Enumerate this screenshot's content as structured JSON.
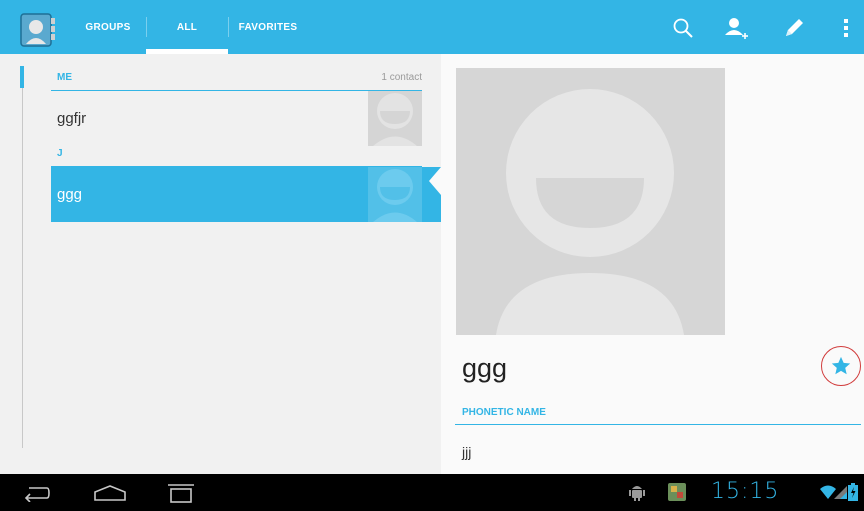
{
  "action_bar": {
    "color": "#33b5e5",
    "tabs": [
      {
        "label": "GROUPS",
        "selected": false
      },
      {
        "label": "ALL",
        "selected": true
      },
      {
        "label": "FAVORITES",
        "selected": false
      }
    ],
    "actions": [
      "search-icon",
      "add-contact-icon",
      "edit-icon",
      "overflow-menu-icon"
    ]
  },
  "contact_list": {
    "sections": [
      {
        "title": "ME",
        "count": "1 contact"
      },
      {
        "title": "J",
        "count": ""
      }
    ],
    "contacts": [
      {
        "name": "ggfjr",
        "selected": false
      },
      {
        "name": "ggg",
        "selected": true
      }
    ]
  },
  "detail": {
    "name": "ggg",
    "starred": true,
    "fields": [
      {
        "label": "PHONETIC NAME",
        "value": "jjj"
      }
    ]
  },
  "system_bar": {
    "nav": [
      "back-icon",
      "home-icon",
      "recent-apps-icon"
    ],
    "time": "15:15",
    "status_icons": [
      "android-debug-icon",
      "app-notification-icon",
      "wifi-icon",
      "signal-icon",
      "battery-icon"
    ]
  }
}
